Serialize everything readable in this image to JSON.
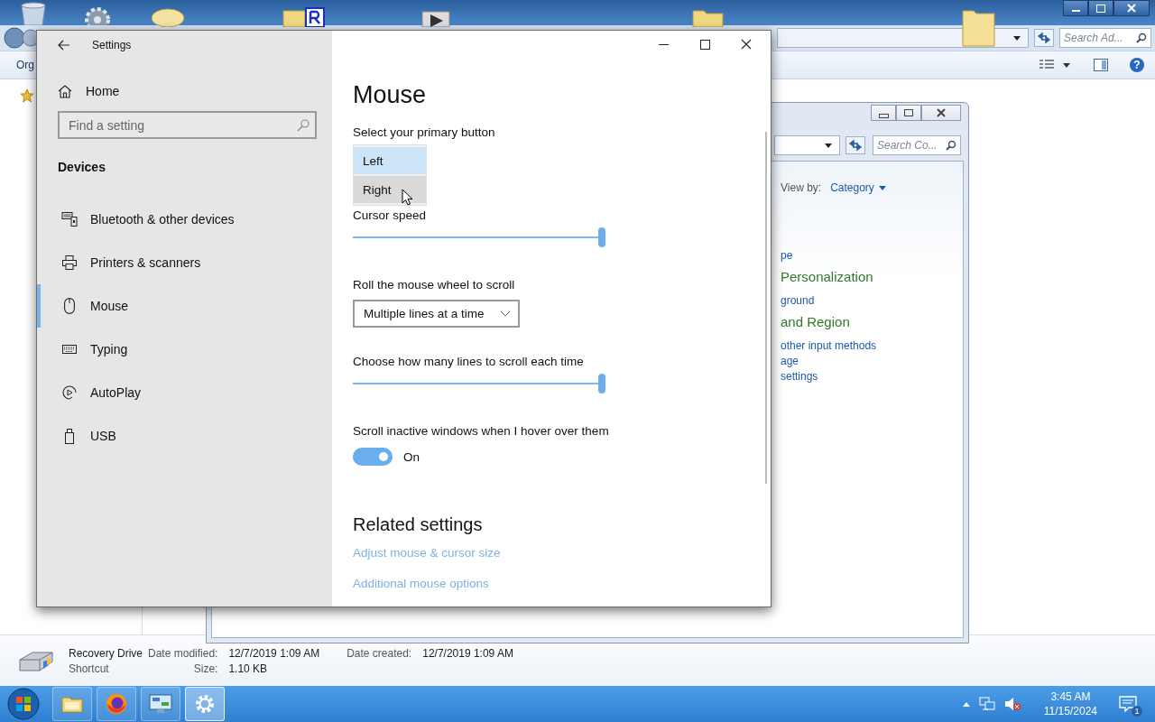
{
  "explorer": {
    "search": {
      "placeholder": "Search Ad..."
    },
    "toolbar_text": "Org",
    "help_glyph": "?",
    "details": {
      "name": "Recovery Drive",
      "type": "Shortcut",
      "fields": [
        {
          "label": "Date modified:",
          "value": "12/7/2019 1:09 AM"
        },
        {
          "label": "Size:",
          "value": "1.10 KB"
        },
        {
          "label": "Date created:",
          "value": "12/7/2019 1:09 AM"
        }
      ]
    }
  },
  "control_panel": {
    "search": {
      "placeholder": "Search Co..."
    },
    "view_by": {
      "label": "View by:",
      "value": "Category"
    },
    "fragments": [
      {
        "kind": "link",
        "text": "pe"
      },
      {
        "kind": "heading",
        "text": "Personalization"
      },
      {
        "kind": "link",
        "text": "ground"
      },
      {
        "kind": "heading",
        "text": "and Region"
      },
      {
        "kind": "link",
        "text": "other input methods"
      },
      {
        "kind": "link",
        "text": "age"
      },
      {
        "kind": "link",
        "text": "settings"
      }
    ]
  },
  "settings": {
    "title": "Settings",
    "home": "Home",
    "search": {
      "placeholder": "Find a setting"
    },
    "section": "Devices",
    "nav": [
      {
        "label": "Bluetooth & other devices",
        "selected": false
      },
      {
        "label": "Printers & scanners",
        "selected": false
      },
      {
        "label": "Mouse",
        "selected": true
      },
      {
        "label": "Typing",
        "selected": false
      },
      {
        "label": "AutoPlay",
        "selected": false
      },
      {
        "label": "USB",
        "selected": false
      }
    ],
    "page_title": "Mouse",
    "primary_button": {
      "label": "Select your primary button",
      "options": [
        {
          "label": "Left",
          "selected": true,
          "hovered": false
        },
        {
          "label": "Right",
          "selected": false,
          "hovered": true
        }
      ]
    },
    "cursor_speed": {
      "label": "Cursor speed",
      "level": 1.0
    },
    "wheel": {
      "label": "Roll the mouse wheel to scroll",
      "value": "Multiple lines at a time"
    },
    "lines": {
      "label": "Choose how many lines to scroll each time",
      "level": 1.0
    },
    "inactive": {
      "label": "Scroll inactive windows when I hover over them",
      "on": true,
      "state_text": "On"
    },
    "related": {
      "title": "Related settings",
      "links": [
        "Adjust mouse & cursor size",
        "Additional mouse options"
      ]
    }
  },
  "taskbar": {
    "apps": [
      {
        "kind": "explorer",
        "selected": false
      },
      {
        "kind": "firefox",
        "selected": false
      },
      {
        "kind": "control-panel",
        "selected": false
      },
      {
        "kind": "settings",
        "selected": true
      }
    ],
    "time": "3:45 AM",
    "date": "11/15/2024",
    "notifications": "1"
  }
}
